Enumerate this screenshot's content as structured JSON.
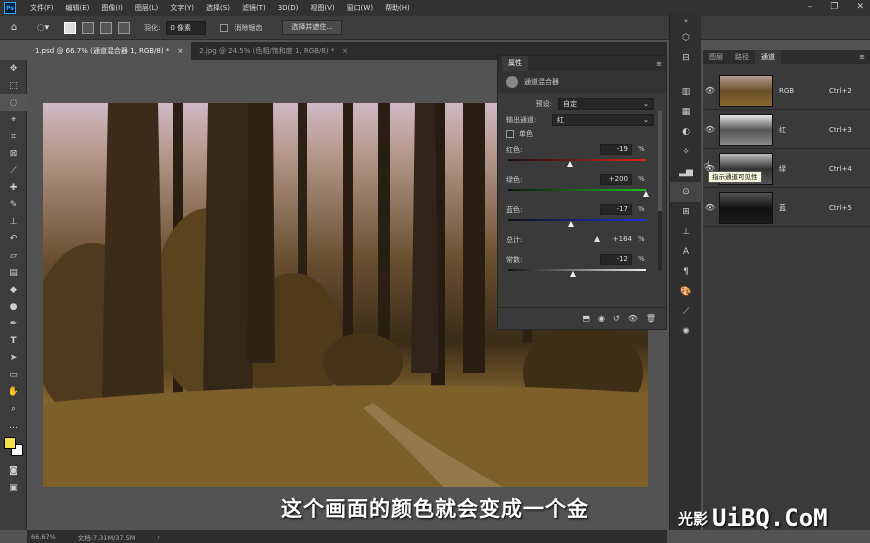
{
  "menubar": {
    "logo": "Ps",
    "items": [
      "文件(F)",
      "编辑(E)",
      "图像(I)",
      "图层(L)",
      "文字(Y)",
      "选择(S)",
      "滤镜(T)",
      "3D(D)",
      "视图(V)",
      "窗口(W)",
      "帮助(H)"
    ]
  },
  "options": {
    "feather_label": "羽化:",
    "feather_value": "0 像素",
    "antialias_label": "消除锯齿",
    "select_mask_button": "选择并遮住..."
  },
  "tabs": [
    {
      "label": "1.psd @ 66.7% (通道混合器 1, RGB/8) *"
    },
    {
      "label": "2.jpg @ 24.5% (色相/饱和度 1, RGB/8) *"
    }
  ],
  "status": {
    "zoom": "66.67%",
    "doc": "文档:7.31M/37.5M"
  },
  "properties": {
    "tab": "属性",
    "title": "通道混合器",
    "preset_label": "预设:",
    "preset_value": "自定",
    "output_label": "输出通道:",
    "output_value": "红",
    "mono_label": "单色",
    "sliders": [
      {
        "label": "红色:",
        "value": "-19",
        "pct": "%",
        "pos": 0.45
      },
      {
        "label": "绿色:",
        "value": "+200",
        "pct": "%",
        "pos": 1.0
      },
      {
        "label": "蓝色:",
        "value": "-17",
        "pct": "%",
        "pos": 0.46
      },
      {
        "label": "总计:",
        "value": "+164",
        "pct": "%"
      },
      {
        "label": "常数:",
        "value": "-12",
        "pct": "%",
        "pos": 0.47
      }
    ]
  },
  "channels": {
    "tabs": [
      "图层",
      "路径",
      "通道"
    ],
    "rows": [
      {
        "name": "RGB",
        "shortcut": "Ctrl+2"
      },
      {
        "name": "红",
        "shortcut": "Ctrl+3"
      },
      {
        "name": "绿",
        "shortcut": "Ctrl+4"
      },
      {
        "name": "蓝",
        "shortcut": "Ctrl+5"
      }
    ],
    "tooltip": "指示通道可见性"
  },
  "subtitle": "这个画面的颜色就会变成一个金",
  "watermark": {
    "cn": "光影",
    "en": "UiBQ.CoM"
  },
  "colors": {
    "foreground": "#f5e04a",
    "background": "#ffffff"
  }
}
